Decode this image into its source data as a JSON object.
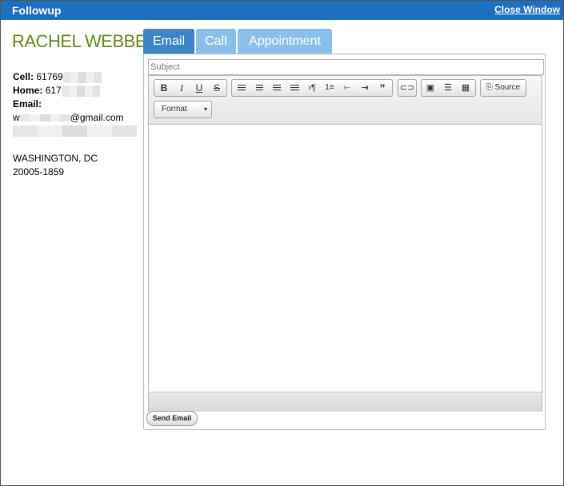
{
  "window": {
    "title": "Followup",
    "close_label": "Close Window"
  },
  "contact": {
    "name": "RACHEL WEBBER",
    "cell_label": "Cell:",
    "cell_value": "61769",
    "home_label": "Home:",
    "home_value": "617",
    "email_label": "Email:",
    "email_prefix": "w",
    "email_suffix": "@gmail.com",
    "city_state": "WASHINGTON, DC",
    "zip": "20005-1859"
  },
  "tabs": [
    {
      "label": "Email",
      "active": true
    },
    {
      "label": "Call",
      "active": false
    },
    {
      "label": "Appointment",
      "active": false
    }
  ],
  "compose": {
    "subject_placeholder": "Subject",
    "source_label": "Source",
    "format_label": "Format",
    "send_label": "Send Email"
  },
  "icons": [
    "bold-icon",
    "italic-icon",
    "underline-icon",
    "strikethrough-icon",
    "align-left-icon",
    "align-center-icon",
    "align-right-icon",
    "justify-icon",
    "ltr-icon",
    "numbered-list-icon",
    "outdent-icon",
    "indent-icon",
    "blockquote-icon",
    "link-icon",
    "image-icon",
    "horizontal-rule-icon",
    "table-icon",
    "source-icon"
  ],
  "colors": {
    "titlebar": "#1d6fbf",
    "tab_active": "#3a86c8",
    "tab_inactive": "#88c0ea",
    "name": "#5f8a1f"
  }
}
